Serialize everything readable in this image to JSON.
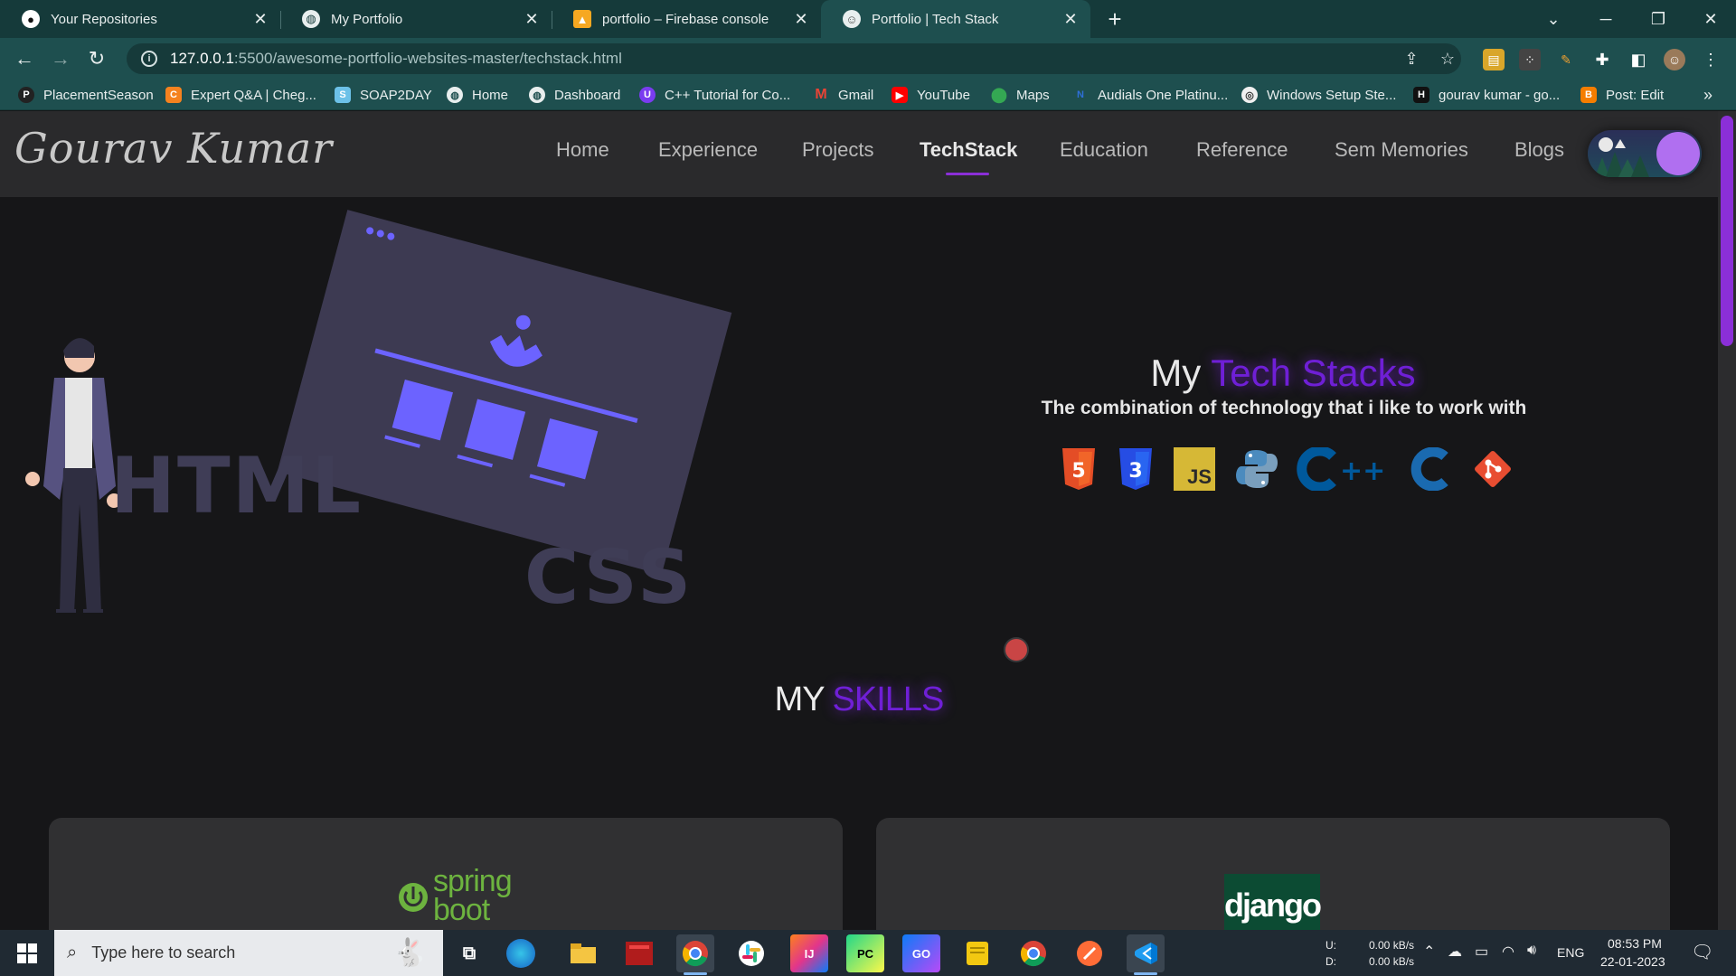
{
  "browser": {
    "tabs": [
      {
        "title": "Your Repositories",
        "icon": "github-icon",
        "active": false
      },
      {
        "title": "My Portfolio",
        "icon": "globe-icon",
        "active": false
      },
      {
        "title": "portfolio – Firebase console",
        "icon": "firebase-icon",
        "active": false
      },
      {
        "title": "Portfolio | Tech Stack",
        "icon": "avatar-icon",
        "active": true
      }
    ],
    "url_host": "127.0.0.1",
    "url_path": ":5500/awesome-portfolio-websites-master/techstack.html",
    "bookmarks": [
      {
        "label": "PlacementSeason",
        "icon": "placement-icon",
        "color": "#222222"
      },
      {
        "label": "Expert Q&A | Cheg...",
        "icon": "chegg-icon",
        "color": "#f5821f"
      },
      {
        "label": "SOAP2DAY",
        "icon": "soap2day-icon",
        "color": "#6cc1e8"
      },
      {
        "label": "Home",
        "icon": "globe-icon",
        "color": "#3b6b6b"
      },
      {
        "label": "Dashboard",
        "icon": "globe-icon",
        "color": "#3b6b6b"
      },
      {
        "label": "C++ Tutorial for Co...",
        "icon": "codehelp-icon",
        "color": "#7a3cf0"
      },
      {
        "label": "Gmail",
        "icon": "gmail-icon",
        "color": "#d93025"
      },
      {
        "label": "YouTube",
        "icon": "youtube-icon",
        "color": "#ff0000"
      },
      {
        "label": "Maps",
        "icon": "maps-icon",
        "color": "#34a853"
      },
      {
        "label": "Audials One Platinu...",
        "icon": "audials-icon",
        "color": "#2e6fd8"
      },
      {
        "label": "Windows Setup Ste...",
        "icon": "windows-setup-icon",
        "color": "#f0c020"
      },
      {
        "label": "gourav kumar - go...",
        "icon": "hashnode-icon",
        "color": "#111111"
      },
      {
        "label": "Post: Edit",
        "icon": "blogger-icon",
        "color": "#f57d00"
      }
    ],
    "more_bookmarks": "»"
  },
  "site": {
    "logo": "Gourav Kumar",
    "nav": [
      "Home",
      "Experience",
      "Projects",
      "TechStack",
      "Education",
      "Reference",
      "Sem Memories",
      "Blogs"
    ],
    "active_nav": "TechStack",
    "hero": {
      "title_plain": "My",
      "title_accent": "Tech Stacks",
      "subtitle": "The combination of technology that i like to work with"
    },
    "illustration": {
      "html_label": "HTML",
      "css_label": "CSS"
    },
    "tech_icons": [
      {
        "name": "html5-icon",
        "glyph": "5",
        "color": "#e44d26"
      },
      {
        "name": "css3-icon",
        "glyph": "3",
        "color": "#264de4"
      },
      {
        "name": "javascript-icon",
        "glyph": "JS",
        "color": "#d6b836"
      },
      {
        "name": "python-icon",
        "glyph": "Py",
        "color": "#4b8bbe"
      },
      {
        "name": "cplusplus-icon",
        "glyph": "C++",
        "color": "#00599c"
      },
      {
        "name": "c-icon",
        "glyph": "C",
        "color": "#1a6ab0"
      },
      {
        "name": "git-icon",
        "glyph": "◆",
        "color": "#e84d31"
      }
    ],
    "skills_title_plain": "MY",
    "skills_title_accent": "SKILLS",
    "cards": [
      {
        "logo_text": "spring boot",
        "logo_color": "#6db33f"
      },
      {
        "logo_text": "django",
        "logo_color": "#0c4b33"
      }
    ],
    "accent_color": "#6f1fd6"
  },
  "taskbar": {
    "search_placeholder": "Type here to search",
    "apps": [
      {
        "name": "task-view-icon",
        "glyph": "▭",
        "color": "#2b3640"
      },
      {
        "name": "edge-icon",
        "glyph": "e",
        "color": "#1ea1d9"
      },
      {
        "name": "file-explorer-icon",
        "glyph": "▬",
        "color": "#f4c542"
      },
      {
        "name": "red-app-icon",
        "glyph": "▦",
        "color": "#b01c1c"
      },
      {
        "name": "chrome-icon",
        "glyph": "●",
        "color": "#db4437"
      },
      {
        "name": "slack-icon",
        "glyph": "✱",
        "color": "#4a154b"
      },
      {
        "name": "intellij-icon",
        "glyph": "IJ",
        "color": "#e2358b"
      },
      {
        "name": "pycharm-icon",
        "glyph": "PC",
        "color": "#21d789"
      },
      {
        "name": "goland-icon",
        "glyph": "GO",
        "color": "#6e4ed8"
      },
      {
        "name": "sticky-notes-icon",
        "glyph": "▮",
        "color": "#f2c811"
      },
      {
        "name": "chrome-alt-icon",
        "glyph": "●",
        "color": "#db4437"
      },
      {
        "name": "postman-icon",
        "glyph": "➚",
        "color": "#ff6c37"
      },
      {
        "name": "vscode-icon",
        "glyph": "⟨⟩",
        "color": "#0078d4"
      }
    ],
    "net_up_label": "U:",
    "net_down_label": "D:",
    "net_up": "0.00 kB/s",
    "net_down": "0.00 kB/s",
    "lang": "ENG",
    "time": "08:53 PM",
    "date": "22-01-2023"
  }
}
